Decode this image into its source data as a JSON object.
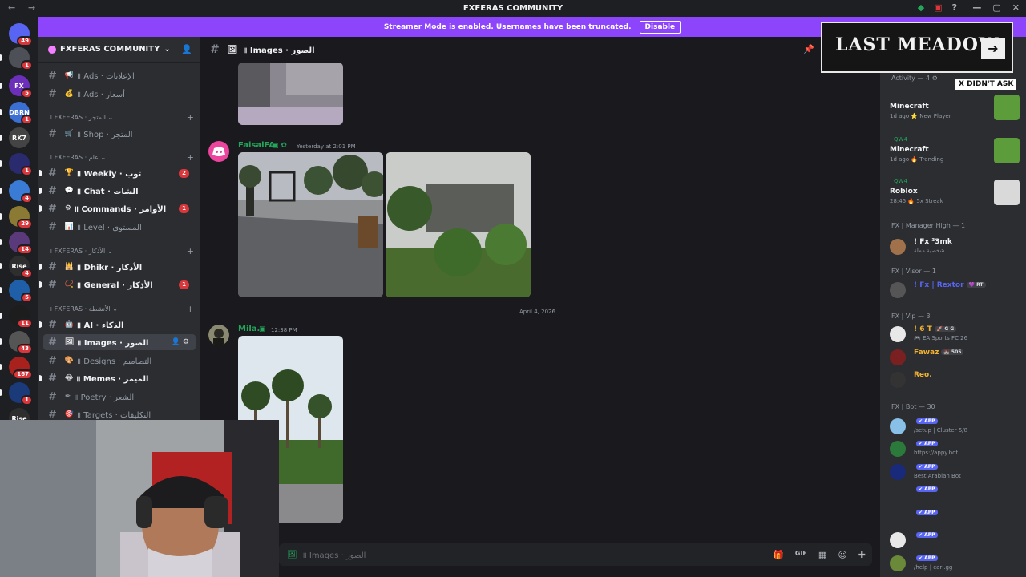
{
  "window": {
    "title": "FXFERAS COMMUNITY",
    "nav": "← →",
    "controls": [
      "—",
      "▢",
      "✕"
    ],
    "tray_icons": [
      "◆",
      "▣",
      "?"
    ]
  },
  "servers": [
    {
      "label": "",
      "color": "#5865f2",
      "badge": "49"
    },
    {
      "label": "",
      "color": "#4e5058",
      "badge": "1"
    },
    {
      "label": "FX",
      "color": "#6b2fba",
      "badge": "5"
    },
    {
      "label": "DBRN",
      "color": "#3b6fd4",
      "badge": "1"
    },
    {
      "label": "RK7",
      "color": "#444",
      "badge": ""
    },
    {
      "label": "",
      "color": "#2a2a6e",
      "badge": "1"
    },
    {
      "label": "",
      "color": "#3a7bd5",
      "badge": "4"
    },
    {
      "label": "",
      "color": "#8a7a33",
      "badge": "29"
    },
    {
      "label": "",
      "color": "#5a3a7a",
      "badge": "14"
    },
    {
      "label": "Rise",
      "color": "#2e2e2e",
      "badge": "4"
    },
    {
      "label": "",
      "color": "#1e5fa8",
      "badge": "5"
    },
    {
      "label": "",
      "color": "#1d1d1d",
      "badge": "11"
    },
    {
      "label": "",
      "color": "#555",
      "badge": "43"
    },
    {
      "label": "",
      "color": "#a8211d",
      "badge": "167"
    },
    {
      "label": "",
      "color": "#1a3a7a",
      "badge": "1"
    },
    {
      "label": "Rise",
      "color": "#2e2e2e",
      "badge": ""
    }
  ],
  "banner": {
    "text": "Streamer Mode is enabled. Usernames have been truncated.",
    "button": "Disable"
  },
  "guild": {
    "name": "FXFERAS COMMUNITY",
    "chevron": "⌄"
  },
  "channels": [
    {
      "type": "ch",
      "emoji": "📢",
      "label": "॥ Ads · الإعلانات",
      "state": "muted"
    },
    {
      "type": "ch",
      "emoji": "💰",
      "label": "॥ Ads · أسعار",
      "state": "muted"
    },
    {
      "type": "cat",
      "label": "। FXFERAS · المتجر ⌄"
    },
    {
      "type": "ch",
      "emoji": "🛒",
      "label": "॥ Shop · المتجر",
      "state": "muted"
    },
    {
      "type": "cat",
      "label": "। FXFERAS · عام ⌄"
    },
    {
      "type": "ch",
      "emoji": "🏆",
      "label": "॥ Weekly · توب",
      "state": "unread",
      "badge": "2",
      "icon": "📢"
    },
    {
      "type": "ch",
      "emoji": "💬",
      "label": "॥ Chat · الشات",
      "state": "unread"
    },
    {
      "type": "ch",
      "emoji": "⚙",
      "label": "॥ Commands · الأوامر",
      "state": "unread",
      "badge": "1"
    },
    {
      "type": "ch",
      "emoji": "📊",
      "label": "॥ Level · المستوى",
      "state": "muted"
    },
    {
      "type": "cat",
      "label": "। FXFERAS · الأذكار ⌄"
    },
    {
      "type": "ch",
      "emoji": "🕌",
      "label": "॥ Dhikr · الأذكار",
      "state": "unread"
    },
    {
      "type": "ch",
      "emoji": "📿",
      "label": "॥ General · الأذكار",
      "state": "unread",
      "badge": "1"
    },
    {
      "type": "cat",
      "label": "। FXFERAS · الأنشطة ⌄"
    },
    {
      "type": "ch",
      "emoji": "🤖",
      "label": "॥ AI · الذكاء",
      "state": "unread"
    },
    {
      "type": "ch",
      "emoji": "🖼",
      "label": "॥ Images · الصور",
      "state": "active"
    },
    {
      "type": "ch",
      "emoji": "🎨",
      "label": "॥ Designs · التصاميم",
      "state": "muted"
    },
    {
      "type": "ch",
      "emoji": "😂",
      "label": "॥ Memes · الميمز",
      "state": "unread"
    },
    {
      "type": "ch",
      "emoji": "✒",
      "label": "॥ Poetry · الشعر",
      "state": "muted"
    },
    {
      "type": "ch",
      "emoji": "🎯",
      "label": "॥ Targets · التكليفات",
      "state": "muted"
    }
  ],
  "channel_header": {
    "hash": "#",
    "emoji": "🖼",
    "title": "॥ Images · الصور",
    "pin": "📌"
  },
  "messages": [
    {
      "author": "FaisalFA",
      "author_color": "#23a55a",
      "timestamp": "Yesterday at 2:01 PM"
    },
    {
      "author": "Mila.",
      "author_color": "#23a55a",
      "timestamp": "12:38 PM"
    }
  ],
  "date_divider": "April 4, 2026",
  "composer": {
    "placeholder": "॥ Images · الصور",
    "icons": [
      "🎁",
      "GIF",
      "▦",
      "☺",
      "✚"
    ]
  },
  "members_panel": {
    "activity_header": "Activity — 4 ⚙",
    "activities": [
      {
        "name": "",
        "title": "Minecraft",
        "meta": "1d ago  ⭐ New Player",
        "icon_color": "#5d9c3b"
      },
      {
        "name": "! QW4",
        "title": "Minecraft",
        "meta": "1d ago  🔥 Trending",
        "icon_color": "#5d9c3b"
      },
      {
        "name": "! QW4",
        "title": "Roblox",
        "meta": "28:45  🔥 5x Streak",
        "icon_color": "#d9d9d9"
      }
    ],
    "groups": [
      {
        "title": "FX | Manager High — 1",
        "members": [
          {
            "name": "! Fx ³3mk",
            "status": "شخصية مملة",
            "color": "#f2f3f5",
            "tag": "",
            "av": "#a0714a"
          }
        ]
      },
      {
        "title": "FX | Visor — 1",
        "members": [
          {
            "name": "! Fx | Rextor",
            "status": "",
            "color": "#5865f2",
            "tag": "💜 RT",
            "av": "#555"
          }
        ]
      },
      {
        "title": "FX | Vip — 3",
        "members": [
          {
            "name": "! 6 T",
            "status": "🎮 EA Sports FC 26",
            "color": "#f0b232",
            "tag": "🚀 G G",
            "av": "#e8e8e8"
          },
          {
            "name": "Fawaz",
            "status": "",
            "color": "#f0b232",
            "tag": "🏰 505",
            "av": "#7a2020"
          },
          {
            "name": "Reo.",
            "status": "",
            "color": "#f0b232",
            "tag": "",
            "av": "#333"
          }
        ]
      },
      {
        "title": "FX | Bot — 30",
        "members": [
          {
            "name": "",
            "status": "/setup | Cluster 5/8",
            "color": "#5865f2",
            "tag": "✔ APP",
            "av": "#88c0e8"
          },
          {
            "name": "",
            "status": "https://appy.bot",
            "color": "#5865f2",
            "tag": "✔ APP",
            "av": "#2b7a3b"
          },
          {
            "name": "",
            "status": "Best Arabian Bot",
            "color": "#5865f2",
            "tag": "✔ APP",
            "av": "#1a2a7a"
          },
          {
            "name": "",
            "status": "",
            "color": "#5865f2",
            "tag": "✔ APP",
            "av": "#2b2d31"
          },
          {
            "name": "",
            "status": "",
            "color": "#5865f2",
            "tag": "✔ APP",
            "av": "#2b2d31"
          },
          {
            "name": "",
            "status": "",
            "color": "#5865f2",
            "tag": "✔ APP",
            "av": "#e8e8e8"
          },
          {
            "name": "",
            "status": "/help | carl.gg",
            "color": "#5865f2",
            "tag": "✔ APP",
            "av": "#6a8a3a"
          }
        ]
      }
    ]
  },
  "overlay": {
    "logo_text": "LAST MEADOW",
    "logo_arrow": "➔",
    "sticker": "X DIDN'T ASK"
  }
}
